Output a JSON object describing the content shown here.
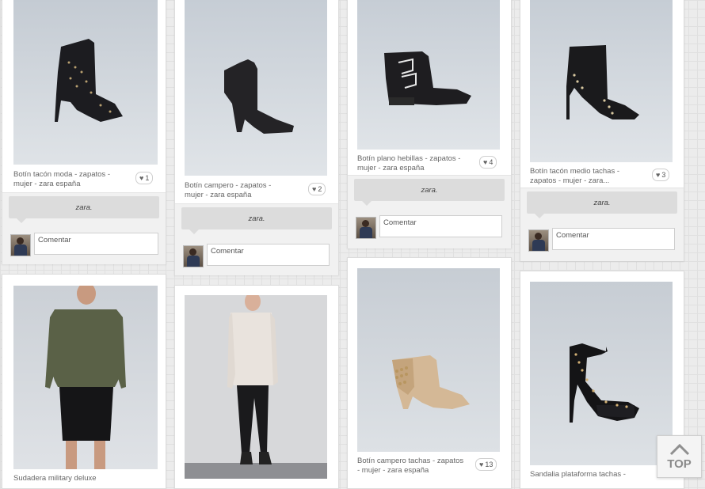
{
  "source_label": "zara.",
  "comment_placeholder": "Comentar",
  "top_button_label": "TOP",
  "like_icon": "heart-icon",
  "pins": [
    {
      "description": "Botín tacón moda - zapatos - mujer - zara españa",
      "likes": "1",
      "image": "studded-ankle-boot"
    },
    {
      "description": "Botín campero - zapatos - mujer - zara españa",
      "likes": "2",
      "image": "suede-cowboy-bootie"
    },
    {
      "description": "Botín plano hebillas - zapatos - mujer - zara españa",
      "likes": "4",
      "image": "flat-buckle-bootie"
    },
    {
      "description": "Botín tacón medio tachas - zapatos - mujer - zara...",
      "likes": "3",
      "image": "studded-mid-heel-bootie"
    },
    {
      "description": "Sudadera military deluxe",
      "likes": "",
      "image": "khaki-sweater-model"
    },
    {
      "description": "",
      "likes": "",
      "image": "white-knit-sweater-model"
    },
    {
      "description": "Botín campero tachas - zapatos - mujer - zara españa",
      "likes": "13",
      "image": "beige-studded-bootie"
    },
    {
      "description": "Sandalia plataforma tachas -",
      "likes": "",
      "image": "studded-platform-sandal"
    }
  ]
}
